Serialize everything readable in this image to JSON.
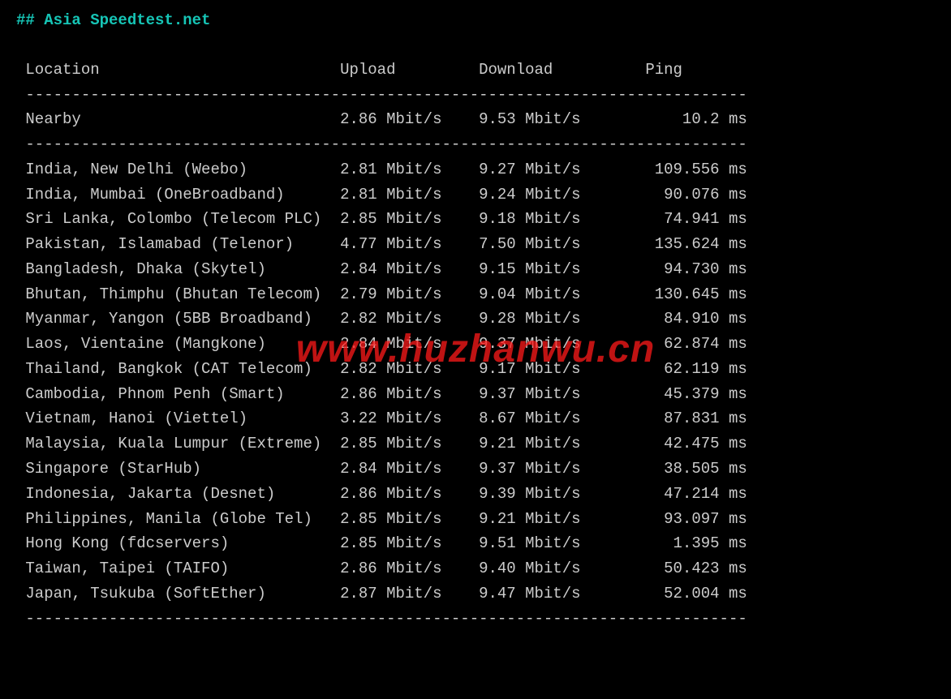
{
  "title": "## Asia Speedtest.net",
  "watermark": "www.huzhanwu.cn",
  "columns": {
    "location": "Location",
    "upload": "Upload",
    "download": "Download",
    "ping": "Ping"
  },
  "nearby": {
    "label": "Nearby",
    "upload": "2.86 Mbit/s",
    "download": "9.53 Mbit/s",
    "ping": "10.2 ms"
  },
  "rows": [
    {
      "location": "India, New Delhi (Weebo)",
      "upload": "2.81 Mbit/s",
      "download": "9.27 Mbit/s",
      "ping": "109.556 ms"
    },
    {
      "location": "India, Mumbai (OneBroadband)",
      "upload": "2.81 Mbit/s",
      "download": "9.24 Mbit/s",
      "ping": "90.076 ms"
    },
    {
      "location": "Sri Lanka, Colombo (Telecom PLC)",
      "upload": "2.85 Mbit/s",
      "download": "9.18 Mbit/s",
      "ping": "74.941 ms"
    },
    {
      "location": "Pakistan, Islamabad (Telenor)",
      "upload": "4.77 Mbit/s",
      "download": "7.50 Mbit/s",
      "ping": "135.624 ms"
    },
    {
      "location": "Bangladesh, Dhaka (Skytel)",
      "upload": "2.84 Mbit/s",
      "download": "9.15 Mbit/s",
      "ping": "94.730 ms"
    },
    {
      "location": "Bhutan, Thimphu (Bhutan Telecom)",
      "upload": "2.79 Mbit/s",
      "download": "9.04 Mbit/s",
      "ping": "130.645 ms"
    },
    {
      "location": "Myanmar, Yangon (5BB Broadband)",
      "upload": "2.82 Mbit/s",
      "download": "9.28 Mbit/s",
      "ping": "84.910 ms"
    },
    {
      "location": "Laos, Vientaine (Mangkone)",
      "upload": "2.84 Mbit/s",
      "download": "9.37 Mbit/s",
      "ping": "62.874 ms"
    },
    {
      "location": "Thailand, Bangkok (CAT Telecom)",
      "upload": "2.82 Mbit/s",
      "download": "9.17 Mbit/s",
      "ping": "62.119 ms"
    },
    {
      "location": "Cambodia, Phnom Penh (Smart)",
      "upload": "2.86 Mbit/s",
      "download": "9.37 Mbit/s",
      "ping": "45.379 ms"
    },
    {
      "location": "Vietnam, Hanoi (Viettel)",
      "upload": "3.22 Mbit/s",
      "download": "8.67 Mbit/s",
      "ping": "87.831 ms"
    },
    {
      "location": "Malaysia, Kuala Lumpur (Extreme)",
      "upload": "2.85 Mbit/s",
      "download": "9.21 Mbit/s",
      "ping": "42.475 ms"
    },
    {
      "location": "Singapore (StarHub)",
      "upload": "2.84 Mbit/s",
      "download": "9.37 Mbit/s",
      "ping": "38.505 ms"
    },
    {
      "location": "Indonesia, Jakarta (Desnet)",
      "upload": "2.86 Mbit/s",
      "download": "9.39 Mbit/s",
      "ping": "47.214 ms"
    },
    {
      "location": "Philippines, Manila (Globe Tel)",
      "upload": "2.85 Mbit/s",
      "download": "9.21 Mbit/s",
      "ping": "93.097 ms"
    },
    {
      "location": "Hong Kong (fdcservers)",
      "upload": "2.85 Mbit/s",
      "download": "9.51 Mbit/s",
      "ping": "1.395 ms"
    },
    {
      "location": "Taiwan, Taipei (TAIFO)",
      "upload": "2.86 Mbit/s",
      "download": "9.40 Mbit/s",
      "ping": "50.423 ms"
    },
    {
      "location": "Japan, Tsukuba (SoftEther)",
      "upload": "2.87 Mbit/s",
      "download": "9.47 Mbit/s",
      "ping": "52.004 ms"
    }
  ],
  "layout": {
    "locW": 34,
    "uploadW": 15,
    "downloadW": 16,
    "pingW": 13,
    "sepLen": 78
  }
}
